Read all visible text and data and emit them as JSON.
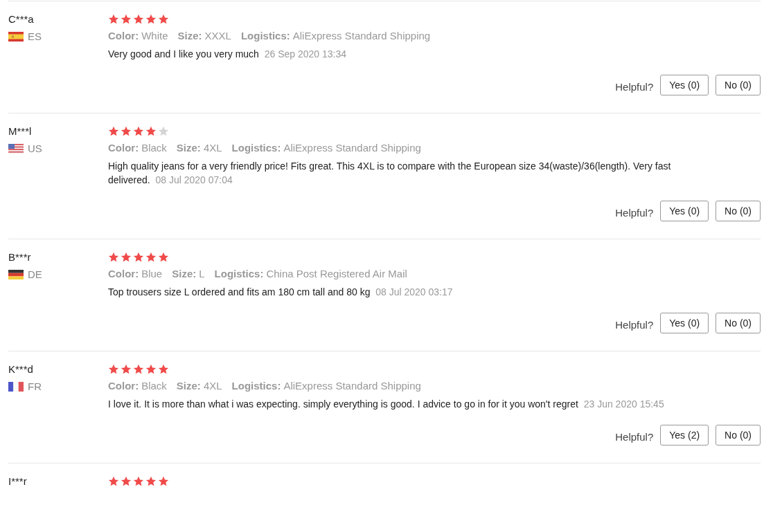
{
  "reviews": [
    {
      "name": "C***a",
      "flag": {
        "kind": "es"
      },
      "country": "ES",
      "stars": 5,
      "attributes": [
        {
          "label": "Color:",
          "value": "White"
        },
        {
          "label": "Size:",
          "value": "XXXL"
        },
        {
          "label": "Logistics:",
          "value": "AliExpress Standard Shipping"
        }
      ],
      "comment": "Very good and I like you very much",
      "date": "26 Sep 2020 13:34",
      "helpful_label": "Helpful?",
      "buttons": [
        "Yes (0)",
        "No (0)"
      ]
    },
    {
      "name": "M***l",
      "flag": {
        "kind": "us"
      },
      "country": "US",
      "stars": 4,
      "attributes": [
        {
          "label": "Color:",
          "value": "Black"
        },
        {
          "label": "Size:",
          "value": "4XL"
        },
        {
          "label": "Logistics:",
          "value": "AliExpress Standard Shipping"
        }
      ],
      "comment": "High quality jeans for a very friendly price! Fits great. This 4XL is to compare with the European size 34(waste)/36(length). Very fast delivered.",
      "date": "08 Jul 2020 07:04",
      "helpful_label": "Helpful?",
      "buttons": [
        "Yes (0)",
        "No (0)"
      ]
    },
    {
      "name": "B***r",
      "flag": {
        "kind": "de"
      },
      "country": "DE",
      "stars": 5,
      "attributes": [
        {
          "label": "Color:",
          "value": "Blue"
        },
        {
          "label": "Size:",
          "value": "L"
        },
        {
          "label": "Logistics:",
          "value": "China Post Registered Air Mail"
        }
      ],
      "comment": "Top trousers size L ordered and fits am 180 cm tall and 80 kg",
      "date": "08 Jul 2020 03:17",
      "helpful_label": "Helpful?",
      "buttons": [
        "Yes (0)",
        "No (0)"
      ]
    },
    {
      "name": "K***d",
      "flag": {
        "kind": "fr"
      },
      "country": "FR",
      "stars": 5,
      "attributes": [
        {
          "label": "Color:",
          "value": "Black"
        },
        {
          "label": "Size:",
          "value": "4XL"
        },
        {
          "label": "Logistics:",
          "value": "AliExpress Standard Shipping"
        }
      ],
      "comment": "I love it. It is more than what i was expecting. simply everything is good. I advice to go in for it you won't regret",
      "date": "23 Jun 2020 15:45",
      "helpful_label": "Helpful?",
      "buttons": [
        "Yes (2)",
        "No (0)"
      ]
    },
    {
      "name": "I***r",
      "stars": 5
    }
  ]
}
